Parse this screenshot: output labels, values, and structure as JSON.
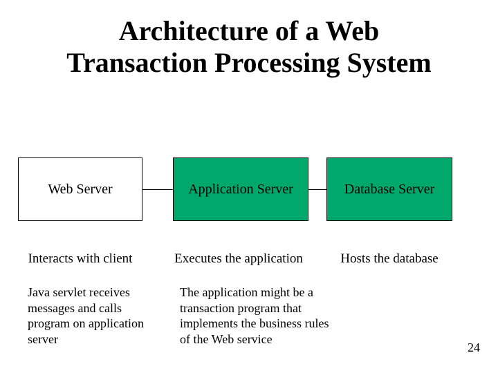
{
  "title": {
    "line1": "Architecture of a Web",
    "line2": "Transaction Processing System"
  },
  "boxes": {
    "web": {
      "label": "Web Server"
    },
    "app": {
      "label": "Application Server"
    },
    "db": {
      "label": "Database Server"
    }
  },
  "captions": {
    "web": "Interacts with client",
    "app": "Executes the application",
    "db": "Hosts the database"
  },
  "details": {
    "web": "Java servlet receives messages and calls program on application server",
    "app": "The application might be a transaction program that implements the business rules of the Web service"
  },
  "page_number": "24"
}
